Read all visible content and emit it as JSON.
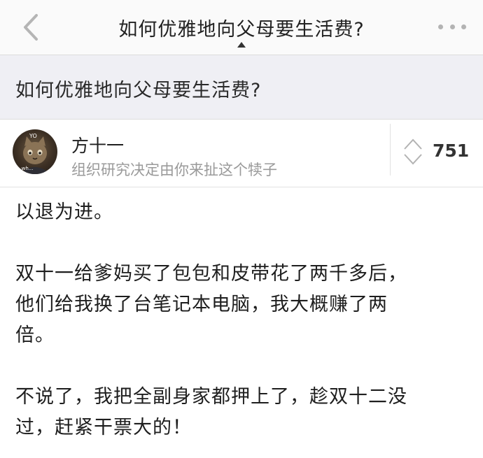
{
  "navbar": {
    "title": "如何优雅地向父母要生活费?"
  },
  "question": {
    "title": "如何优雅地向父母要生活费?"
  },
  "author": {
    "name": "方十一",
    "bio": "组织研究决定由你来扯这个犊子",
    "avatar_text_top": "YO",
    "avatar_text_bottom": "...wh..."
  },
  "vote": {
    "count": "751"
  },
  "answer": {
    "paragraphs": [
      "以退为进。",
      "双十一给爹妈买了包包和皮带花了两千多后，\n他们给我换了台笔记本电脑，我大概赚了两\n倍。",
      "不说了，我把全副身家都押上了，趁双十二没\n过，赶紧干票大的！"
    ]
  },
  "colors": {
    "navbar_bg": "#fafafa",
    "question_bar_bg": "#efeff4",
    "secondary_text": "#9a9a9a",
    "icon_gray": "#b3b3b3"
  }
}
